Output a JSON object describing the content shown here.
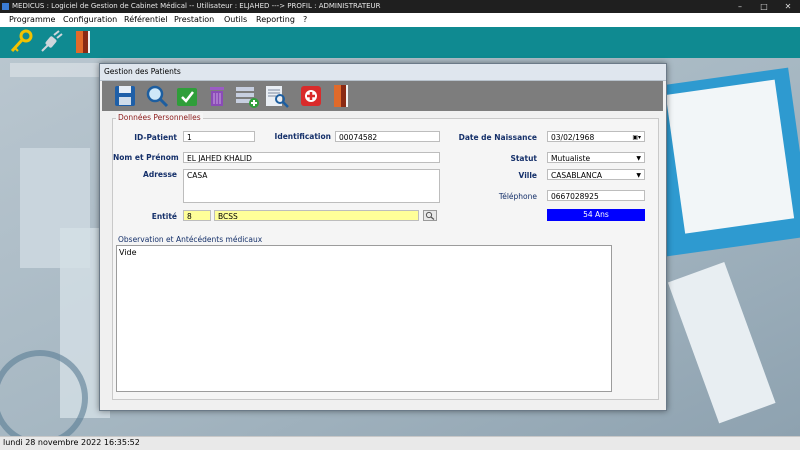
{
  "window": {
    "title": "MEDICUS : Logiciel de Gestion de Cabinet Médical -- Utilisateur : ELJAHED ---> PROFIL : ADMINISTRATEUR",
    "buttons": [
      "–",
      "□",
      "✕"
    ]
  },
  "menu": {
    "items": [
      "Programme",
      "Configuration",
      "Référentiel",
      "Prestation",
      "Outils",
      "Reporting",
      "?"
    ]
  },
  "main_toolbar": {
    "icons": [
      "key-icon",
      "plug-icon",
      "exit-door-icon"
    ]
  },
  "dialog": {
    "title": "Gestion des Patients",
    "toolbar_icons": [
      "save-icon",
      "search-icon",
      "validate-icon",
      "trash-icon",
      "add-record-icon",
      "preview-icon",
      "medical-add-icon",
      "exit-door-icon"
    ],
    "section_personal": "Données Personnelles",
    "fields": {
      "id_patient_label": "ID-Patient",
      "id_patient_value": "1",
      "identification_label": "Identification",
      "identification_value": "00074582",
      "date_naissance_label": "Date de Naissance",
      "date_naissance_value": "03/02/1968",
      "nom_prenom_label": "Nom et Prénom",
      "nom_prenom_value": "EL JAHED KHALID",
      "statut_label": "Statut",
      "statut_value": "Mutualiste",
      "adresse_label": "Adresse",
      "adresse_value": "CASA",
      "ville_label": "Ville",
      "ville_value": "CASABLANCA",
      "telephone_label": "Téléphone",
      "telephone_value": "0667028925",
      "age_value": "54 Ans",
      "entite_label": "Entité",
      "entite_code": "8",
      "entite_name": "BCSS"
    },
    "section_observation": "Observation et Antécédents médicaux",
    "observation_value": "Vide"
  },
  "status": {
    "datetime": "lundi 28 novembre 2022  16:35:52"
  },
  "colors": {
    "toolbar": "#0f8a91",
    "dialog_toolbar": "#7d7d7d",
    "label": "#15306a",
    "section_label": "#8b1a1a",
    "age_badge": "#0000ff",
    "yellow_field": "#ffff99"
  }
}
